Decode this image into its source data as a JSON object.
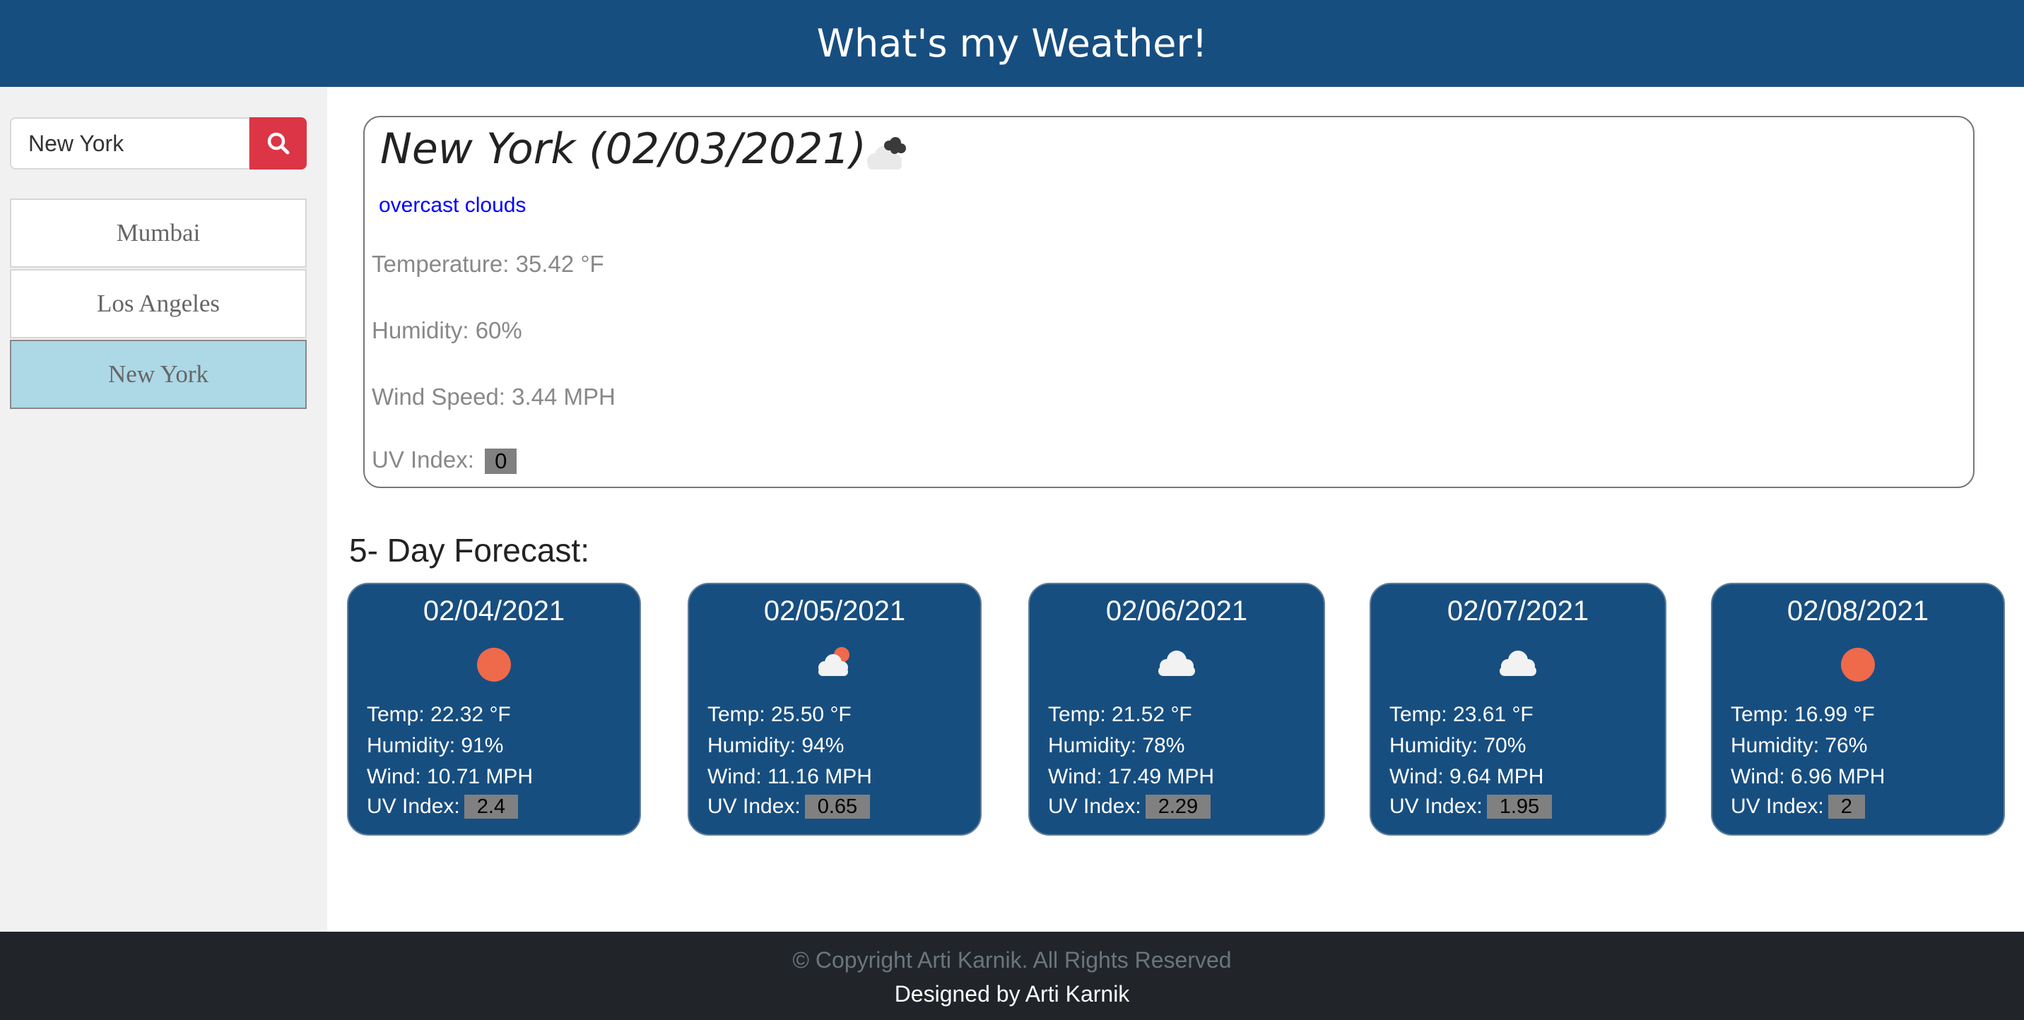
{
  "header": {
    "title": "What's my Weather!"
  },
  "search": {
    "value": "New York",
    "placeholder": "",
    "button_icon": "search-icon"
  },
  "cities": [
    {
      "label": "Mumbai",
      "active": false
    },
    {
      "label": "Los Angeles",
      "active": false
    },
    {
      "label": "New York",
      "active": true
    }
  ],
  "current": {
    "title": "New York (02/03/2021)",
    "icon": "overcast-clouds-icon",
    "description": "overcast clouds",
    "temperature": "Temperature: 35.42 °F",
    "humidity": "Humidity: 60%",
    "wind": "Wind Speed: 3.44 MPH",
    "uv_label": "UV Index:",
    "uv_value": "0"
  },
  "forecast": {
    "heading": "5- Day Forecast:",
    "days": [
      {
        "date": "02/04/2021",
        "icon": "sun-icon",
        "temp": "Temp: 22.32 °F",
        "humidity": "Humidity: 91%",
        "wind": "Wind: 10.71 MPH",
        "uv_label": "UV Index:",
        "uv": "2.4"
      },
      {
        "date": "02/05/2021",
        "icon": "partly-cloudy-icon",
        "temp": "Temp: 25.50 °F",
        "humidity": "Humidity: 94%",
        "wind": "Wind: 11.16 MPH",
        "uv_label": "UV Index:",
        "uv": "0.65"
      },
      {
        "date": "02/06/2021",
        "icon": "cloud-icon",
        "temp": "Temp: 21.52 °F",
        "humidity": "Humidity: 78%",
        "wind": "Wind: 17.49 MPH",
        "uv_label": "UV Index:",
        "uv": "2.29"
      },
      {
        "date": "02/07/2021",
        "icon": "cloud-icon",
        "temp": "Temp: 23.61 °F",
        "humidity": "Humidity: 70%",
        "wind": "Wind: 9.64 MPH",
        "uv_label": "UV Index:",
        "uv": "1.95"
      },
      {
        "date": "02/08/2021",
        "icon": "sun-icon",
        "temp": "Temp: 16.99 °F",
        "humidity": "Humidity: 76%",
        "wind": "Wind: 6.96 MPH",
        "uv_label": "UV Index:",
        "uv": "2"
      }
    ]
  },
  "footer": {
    "copyright": "© Copyright Arti Karnik. All Rights Reserved",
    "designed_by": "Designed by Arti Karnik"
  },
  "colors": {
    "header_bg": "#174e80",
    "search_button": "#dc3545",
    "active_city": "#add8e6",
    "card_bg": "#174e80",
    "sun": "#ee6a4a",
    "footer_bg": "#212529"
  }
}
